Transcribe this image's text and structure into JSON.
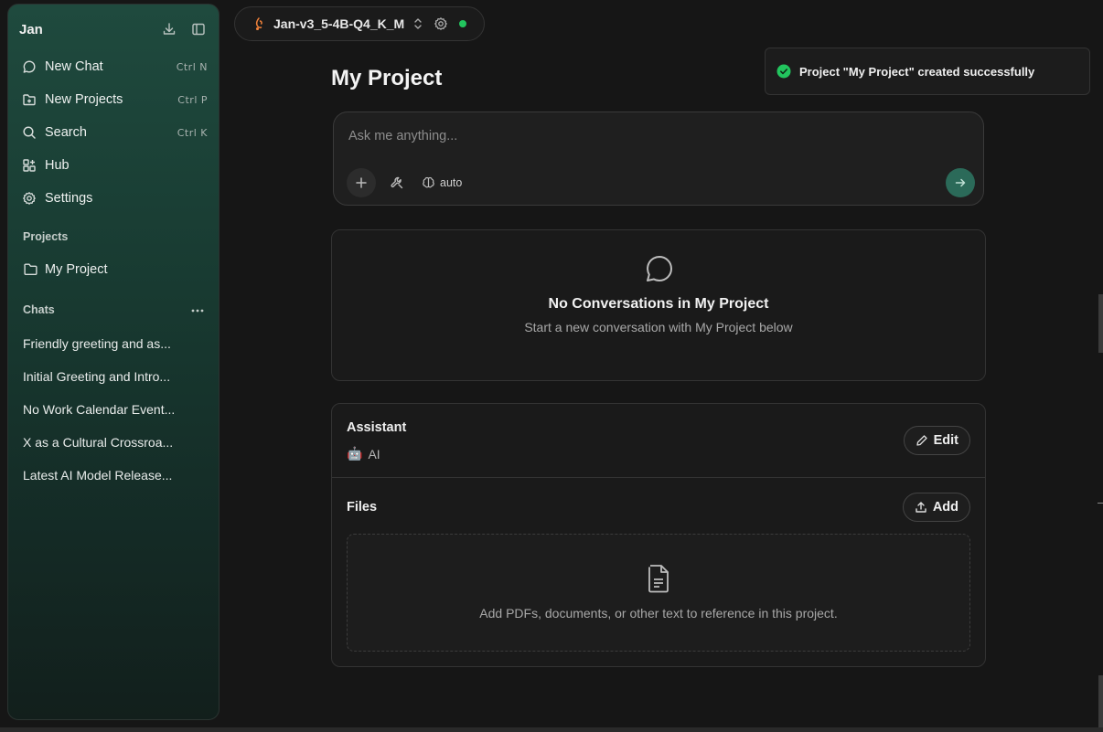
{
  "sidebar": {
    "app_name": "Jan",
    "nav": [
      {
        "label": "New Chat",
        "shortcut": "Ctrl N",
        "icon": "chat-bubble-icon"
      },
      {
        "label": "New Projects",
        "shortcut": "Ctrl P",
        "icon": "folder-plus-icon"
      },
      {
        "label": "Search",
        "shortcut": "Ctrl K",
        "icon": "search-icon"
      },
      {
        "label": "Hub",
        "shortcut": "",
        "icon": "grid-plus-icon"
      },
      {
        "label": "Settings",
        "shortcut": "",
        "icon": "gear-icon"
      }
    ],
    "projects_label": "Projects",
    "projects": [
      {
        "label": "My Project",
        "icon": "folder-icon"
      }
    ],
    "chats_label": "Chats",
    "chats": [
      "Friendly greeting and as...",
      "Initial Greeting and Intro...",
      "No Work Calendar Event...",
      "X as a Cultural Crossroa...",
      "Latest AI Model Release..."
    ]
  },
  "model_selector": {
    "model_name": "Jan-v3_5-4B-Q4_K_M",
    "status_color": "#22c55e"
  },
  "toast": {
    "message": "Project \"My Project\" created successfully"
  },
  "main": {
    "title": "My Project",
    "composer": {
      "placeholder": "Ask me anything...",
      "mode_label": "auto"
    },
    "empty_state": {
      "title": "No Conversations in My Project",
      "subtitle": "Start a new conversation with My Project below"
    },
    "assistant": {
      "heading": "Assistant",
      "avatar": "🤖",
      "name": "AI",
      "edit_label": "Edit"
    },
    "files": {
      "heading": "Files",
      "add_label": "Add",
      "drop_hint": "Add PDFs, documents, or other text to reference in this project."
    }
  },
  "colors": {
    "accent": "#2b6a59",
    "success": "#22c55e"
  }
}
